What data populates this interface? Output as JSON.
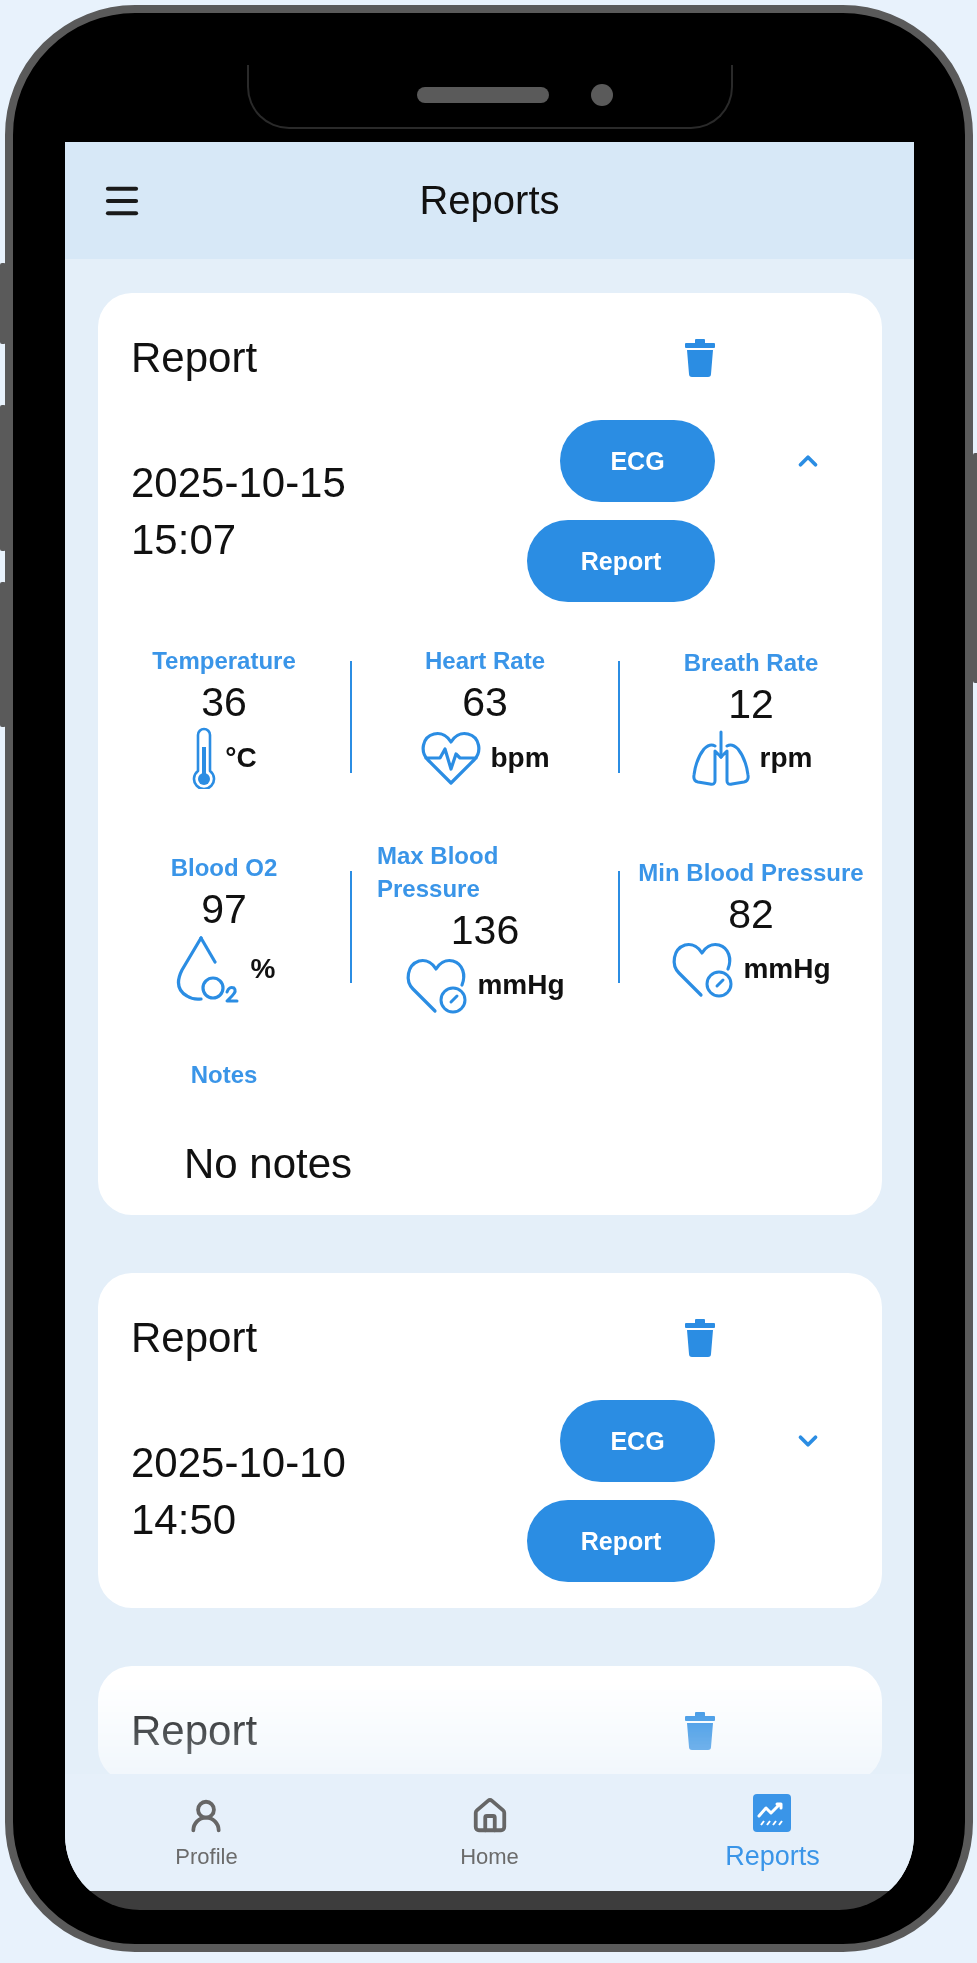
{
  "header": {
    "title": "Reports"
  },
  "reports": [
    {
      "title": "Report",
      "date": "2025-10-15",
      "time": "15:07",
      "expanded": true,
      "buttons": [
        "ECG",
        "Report"
      ],
      "vitals": [
        {
          "kind": "temperature",
          "label": "Temperature",
          "value": "36",
          "unit": "°C"
        },
        {
          "kind": "heart_rate",
          "label": "Heart Rate",
          "value": "63",
          "unit": "bpm"
        },
        {
          "kind": "breath_rate",
          "label": "Breath Rate",
          "value": "12",
          "unit": "rpm"
        },
        {
          "kind": "blood_o2",
          "label": "Blood O2",
          "value": "97",
          "unit": "%"
        },
        {
          "kind": "blood_pressure",
          "label": "Max Blood Pressure",
          "value": "136",
          "unit": "mmHg"
        },
        {
          "kind": "blood_pressure",
          "label": "Min Blood Pressure",
          "value": "82",
          "unit": "mmHg"
        }
      ],
      "notes_label": "Notes",
      "notes": "No notes"
    },
    {
      "title": "Report",
      "date": "2025-10-10",
      "time": "14:50",
      "expanded": false,
      "buttons": [
        "ECG",
        "Report"
      ]
    },
    {
      "title": "Report"
    }
  ],
  "nav": [
    {
      "kind": "profile",
      "label": "Profile",
      "selected": false
    },
    {
      "kind": "home",
      "label": "Home",
      "selected": false
    },
    {
      "kind": "reports",
      "label": "Reports",
      "selected": true
    }
  ]
}
